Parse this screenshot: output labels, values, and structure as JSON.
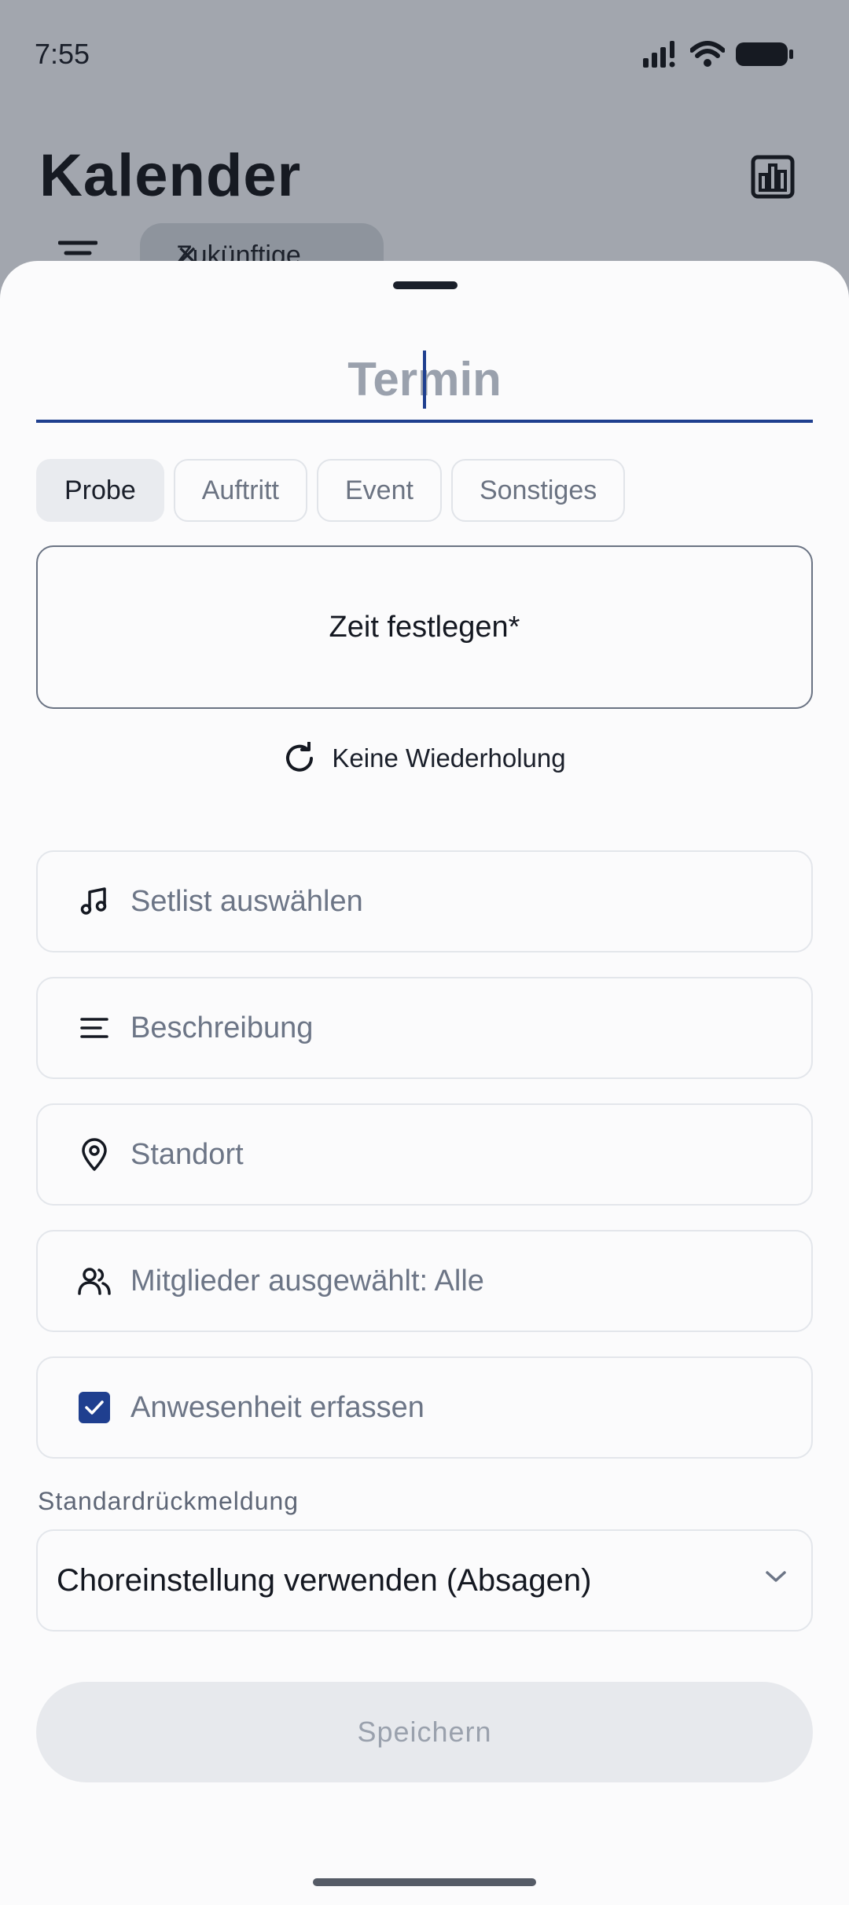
{
  "status_bar": {
    "time": "7:55"
  },
  "background": {
    "title": "Kalender",
    "filter_chip": "Zukünftige"
  },
  "sheet": {
    "title_input": {
      "value": "Termin"
    },
    "event_types": [
      {
        "label": "Probe",
        "selected": true
      },
      {
        "label": "Auftritt",
        "selected": false
      },
      {
        "label": "Event",
        "selected": false
      },
      {
        "label": "Sonstiges",
        "selected": false
      }
    ],
    "time_button": "Zeit festlegen*",
    "repeat": "Keine Wiederholung",
    "fields": {
      "setlist": "Setlist auswählen",
      "description": "Beschreibung",
      "location": "Standort",
      "members": "Mitglieder ausgewählt: Alle",
      "attendance": "Anwesenheit erfassen"
    },
    "attendance_checked": true,
    "default_response": {
      "label": "Standardrückmeldung",
      "value": "Choreinstellung verwenden (Absagen)"
    },
    "save_label": "Speichern"
  },
  "colors": {
    "accent": "#1f3f8f",
    "disabled_text": "#9aa1ad"
  }
}
